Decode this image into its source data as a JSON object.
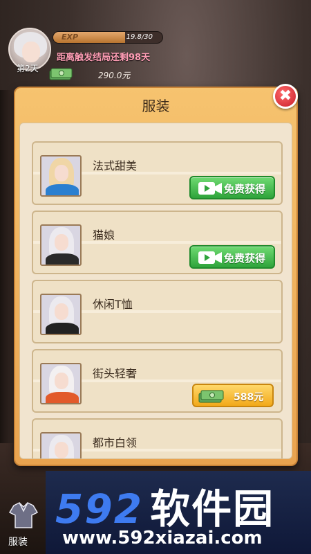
{
  "hud": {
    "day_label": "第2天",
    "exp_label": "EXP",
    "exp_value_text": "19.8/30",
    "exp_progress": 0.66,
    "countdown": "距离触发结局还剩98天",
    "money": "290.0元"
  },
  "modal": {
    "title": "服装",
    "close_symbol": "✖"
  },
  "items": [
    {
      "name": "法式甜美",
      "action": "免费获得",
      "hair": "#f0d6a6",
      "body": "#2a7fd0"
    },
    {
      "name": "猫娘",
      "action": "免费获得",
      "hair": "#eceaef",
      "body": "#2a2a2a"
    },
    {
      "name": "休闲T恤",
      "action": "",
      "hair": "#eceaef",
      "body": "#222222"
    },
    {
      "name": "街头轻奢",
      "price": "588元",
      "hair": "#f3f0f1",
      "body": "#e25a2b"
    },
    {
      "name": "都市白领",
      "action": "",
      "hair": "#eceaef",
      "body": "#f4f4f4"
    }
  ],
  "bottom": {
    "outfit_label": "服装"
  },
  "watermark": {
    "big": "592",
    "cn": "软件园",
    "url": "www.592xiazai.com"
  },
  "colors": {
    "modal_orange": "#f0b55f",
    "free_green": "#34a843",
    "buy_gold": "#f2a91a",
    "close_red": "#d32a36"
  }
}
